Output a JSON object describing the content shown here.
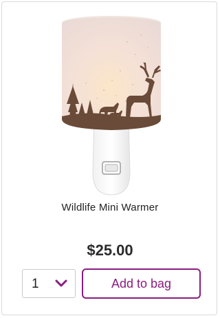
{
  "product": {
    "name": "Wildlife Mini Warmer",
    "price": "$25.00",
    "image_icon": "wildlife-warmer-image"
  },
  "quantity": {
    "selected": "1"
  },
  "actions": {
    "add_to_bag_label": "Add to bag"
  },
  "colors": {
    "brand_accent": "#8a1c80",
    "card_border": "#d9d9d9",
    "price_text": "#2b2b2b"
  }
}
